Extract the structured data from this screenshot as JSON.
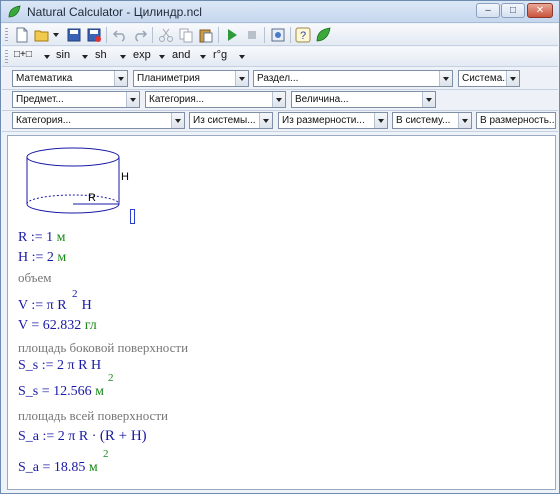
{
  "window": {
    "title": "Natural Calculator - Цилиндр.ncl"
  },
  "titlebar": {
    "minimize": "–",
    "maximize": "□",
    "close": "✕"
  },
  "toolbar_funcs": {
    "insert": "□+□",
    "sin": "sin",
    "sh": "sh",
    "exp": "exp",
    "and": "and",
    "r_g": "r°g"
  },
  "selectors": {
    "row1": [
      "Математика",
      "Планиметрия",
      "Раздел...",
      "Система..."
    ],
    "row2": [
      "Предмет...",
      "Категория...",
      "Величина..."
    ],
    "row3": [
      "Категория...",
      "Из системы...",
      "Из размерности...",
      "В систему...",
      "В размерность..."
    ]
  },
  "figure": {
    "height_label": "H",
    "radius_label": "R"
  },
  "worksheet": {
    "line_R": {
      "var": "R",
      "op": ":=",
      "value": "1",
      "unit": "м"
    },
    "line_H": {
      "var": "H",
      "op": ":=",
      "value": "2",
      "unit": "м"
    },
    "comment_volume": "объем",
    "line_V_def": {
      "var": "V",
      "op": ":=",
      "expr_a": "π R",
      "exp": "2",
      "expr_b": "H"
    },
    "line_V_res": {
      "var": "V",
      "op": "=",
      "value": "62.832",
      "unit": "гл"
    },
    "comment_side": "площадь боковой поверхности",
    "line_Ss_def": {
      "var": "S_s",
      "op": ":=",
      "expr": "2 π R H"
    },
    "line_Ss_res": {
      "var": "S_s",
      "op": "=",
      "value": "12.566",
      "unit": "м",
      "exp": "2"
    },
    "comment_total": "площадь всей поверхности",
    "line_Sa_def": {
      "var": "S_a",
      "op": ":=",
      "expr_a": "2 π R · ",
      "paren": "(R + H)"
    },
    "line_Sa_res": {
      "var": "S_a",
      "op": "=",
      "value": "18.85",
      "unit": "м",
      "exp": "2"
    }
  },
  "colors": {
    "variable": "#1a1aa6",
    "unit": "#1a8a1a",
    "comment": "#777777",
    "run": "#2e9b3a"
  }
}
